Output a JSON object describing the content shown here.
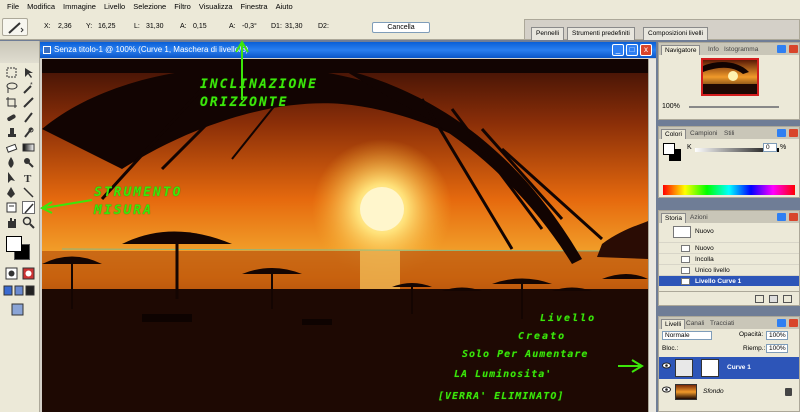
{
  "menubar": {
    "items": [
      "File",
      "Modifica",
      "Immagine",
      "Livello",
      "Selezione",
      "Filtro",
      "Visualizza",
      "Finestra",
      "Aiuto"
    ]
  },
  "options": {
    "x_label": "X:",
    "x_value": "2,36",
    "y_label": "Y:",
    "y_value": "16,25",
    "l_label": "L:",
    "l_value": "31,30",
    "a_label": "A:",
    "a_value": "0,15",
    "angle_label": "A:",
    "angle_value": "-0,3°",
    "d1_label": "D1:",
    "d1_value": "31,30",
    "d2_label": "D2:",
    "cancel_label": "Cancella",
    "well_tabs": [
      "Pennelli",
      "Strumenti predefiniti",
      "Composizioni livelli"
    ]
  },
  "document": {
    "title": "Senza titolo-1 @ 100% (Curve 1, Maschera di livello/8)",
    "min_glyph": "_",
    "max_glyph": "□",
    "close_glyph": "x"
  },
  "navigator": {
    "tabs": [
      "Navigatore",
      "Info",
      "Istogramma"
    ],
    "zoom": "100%"
  },
  "colors": {
    "tabs": [
      "Colori",
      "Campioni",
      "Stili"
    ],
    "k_label": "K",
    "k_value": "0",
    "pct": "%"
  },
  "history": {
    "tabs": [
      "Storia",
      "Azioni"
    ],
    "snapshot": "Nuovo",
    "items": [
      "Nuovo",
      "Incolla",
      "Unico livello",
      "Livello Curve 1"
    ]
  },
  "layers": {
    "tabs": [
      "Livelli",
      "Canali",
      "Tracciati"
    ],
    "blend_mode": "Normale",
    "opacity_label": "Opacità:",
    "opacity_value": "100%",
    "lock_label": "Bloc.:",
    "fill_label": "Riemp.:",
    "fill_value": "100%",
    "items": [
      "Curve 1",
      "Sfondo"
    ]
  },
  "annotations": {
    "inclinazione": [
      "INCLINAZIONE",
      "ORIZZONTE"
    ],
    "strumento": [
      "STRUMENTO",
      "MISURA"
    ],
    "livello": [
      "Livello",
      "Creato",
      "Solo Per Aumentare",
      "LA Luminosita'",
      "[VERRA' ELIMINATO]"
    ]
  },
  "colors_theme": {
    "accent": "#2d55b8",
    "annotation": "#3ce60a",
    "doc_title": "#0a5fd6"
  }
}
